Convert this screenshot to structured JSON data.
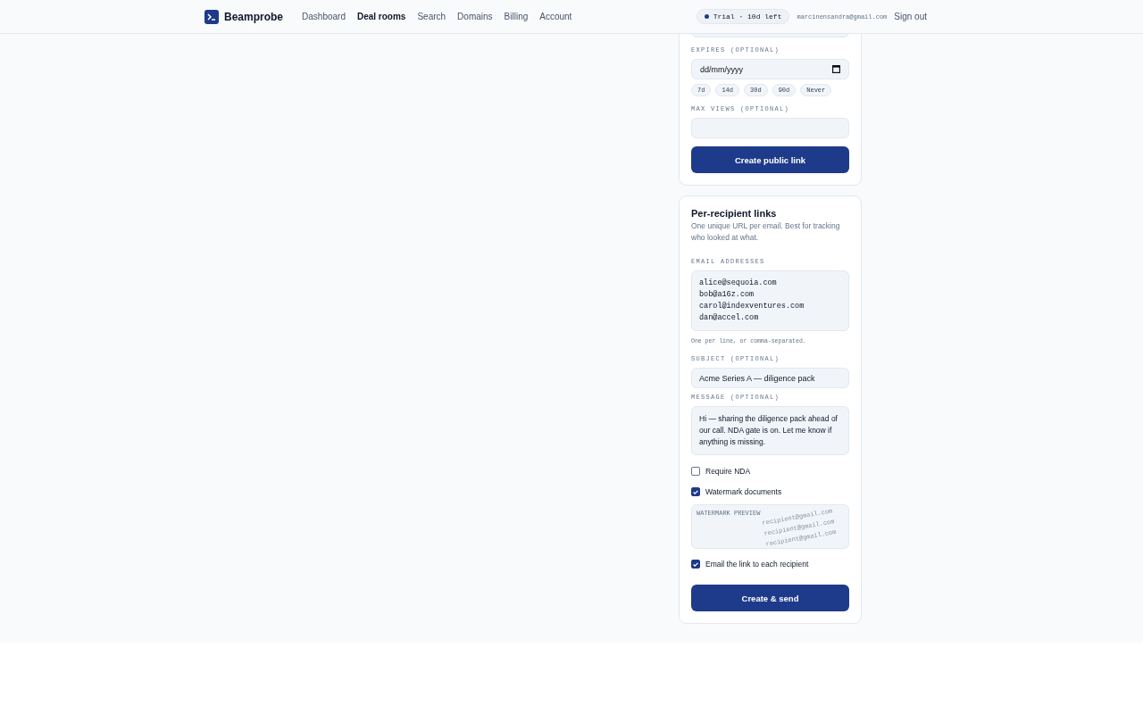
{
  "nav": {
    "brand": "Beamprobe",
    "links": [
      {
        "label": "Dashboard",
        "selected": false
      },
      {
        "label": "Deal rooms",
        "selected": true
      },
      {
        "label": "Search",
        "selected": false
      },
      {
        "label": "Domains",
        "selected": false
      },
      {
        "label": "Billing",
        "selected": false
      },
      {
        "label": "Account",
        "selected": false
      }
    ],
    "trial": "Trial · 10d left",
    "email": "marcinensandra@gmail.com",
    "sign_out": "Sign out"
  },
  "public_link": {
    "expires_label": "EXPIRES (OPTIONAL)",
    "expires_placeholder": "dd/mm/yyyy",
    "presets": [
      "7d",
      "14d",
      "30d",
      "90d",
      "Never"
    ],
    "max_views_label": "MAX VIEWS (OPTIONAL)",
    "button": "Create public link"
  },
  "recipients": {
    "title": "Per-recipient links",
    "description": "One unique URL per email. Best for tracking who looked at what.",
    "emails_label": "EMAIL ADDRESSES",
    "emails": [
      "alice@sequoia.com",
      "bob@a16z.com",
      "carol@indexventures.com",
      "dan@accel.com"
    ],
    "emails_hint": "One per line, or comma-separated.",
    "subject_label": "SUBJECT (OPTIONAL)",
    "subject": "Acme Series A — diligence pack",
    "message_label": "MESSAGE (OPTIONAL)",
    "message": "Hi — sharing the diligence pack ahead of our call. NDA gate is on. Let me know if anything is missing.",
    "options": [
      {
        "label": "Require NDA",
        "checked": false
      },
      {
        "label": "Watermark documents",
        "checked": true
      }
    ],
    "watermark": {
      "label": "WATERMARK PREVIEW",
      "lines": [
        "recipient@gmail.com",
        "recipient@gmail.com",
        "recipient@gmail.com"
      ]
    },
    "email_option": {
      "label": "Email the link to each recipient",
      "checked": true
    },
    "button": "Create & send"
  }
}
